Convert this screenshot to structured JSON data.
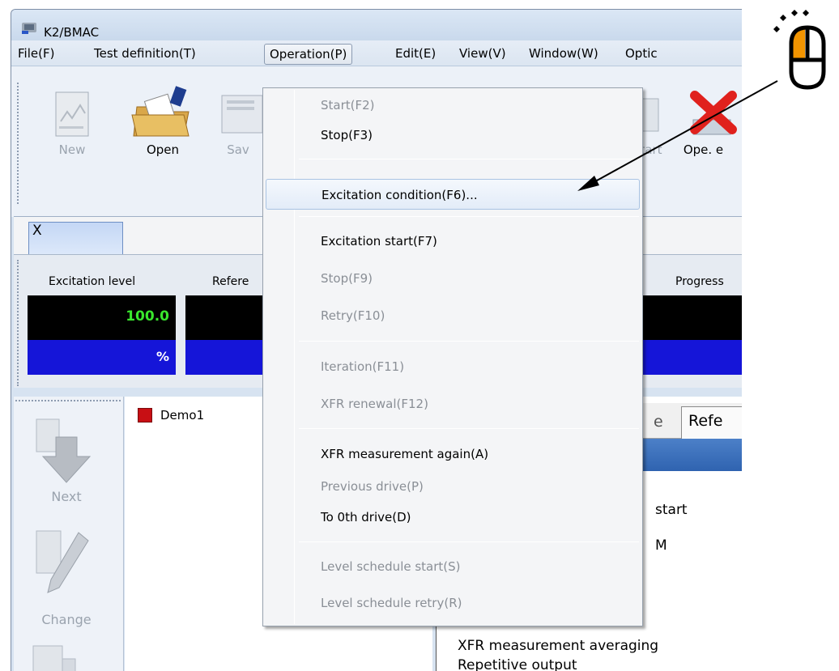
{
  "window": {
    "title": "K2/BMAC"
  },
  "menubar": [
    "File(F)",
    "Test definition(T)",
    "Operation(P)",
    "Edit(E)",
    "View(V)",
    "Window(W)",
    "Optic"
  ],
  "toolbar": {
    "new_label": "New",
    "open_label": "Open",
    "save_label": "Sav",
    "start_label": "tart",
    "ope_label": "Ope. e"
  },
  "tab": {
    "label": "X"
  },
  "monitor": {
    "excitation_label": "Excitation level",
    "reference_label": "Refere",
    "progress_label": "Progress",
    "excitation_value": "100.0",
    "excitation_unit": "%"
  },
  "side_toolbar": {
    "next_label": "Next",
    "change_label": "Change"
  },
  "tree": {
    "item": "Demo1"
  },
  "right_panel": {
    "tabs": [
      "e",
      "Refe"
    ],
    "lines": [
      "start",
      "M",
      "XFR measurement averaging",
      "Repetitive output"
    ]
  },
  "operation_menu": {
    "items": [
      {
        "label": "Start(F2)",
        "enabled": false
      },
      {
        "label": "Stop(F3)",
        "enabled": true
      },
      {
        "label": "Excitation condition(F6)...",
        "enabled": true,
        "highlighted": true
      },
      {
        "label": "Excitation start(F7)",
        "enabled": true
      },
      {
        "label": "Stop(F9)",
        "enabled": false
      },
      {
        "label": "Retry(F10)",
        "enabled": false
      },
      {
        "label": "Iteration(F11)",
        "enabled": false
      },
      {
        "label": "XFR renewal(F12)",
        "enabled": false
      },
      {
        "label": "XFR measurement again(A)",
        "enabled": true
      },
      {
        "label": "Previous drive(P)",
        "enabled": false
      },
      {
        "label": "To 0th drive(D)",
        "enabled": true
      },
      {
        "label": "Level schedule start(S)",
        "enabled": false
      },
      {
        "label": "Level schedule retry(R)",
        "enabled": false
      }
    ]
  },
  "colors": {
    "value_green": "#39e62d",
    "unit_blue": "#1515d8",
    "mouse_accent": "#f29400"
  },
  "icons": [
    "app-icon",
    "new-icon",
    "open-folder-icon",
    "save-icon",
    "ope-end-icon",
    "next-arrow-icon",
    "change-pencil-icon",
    "mouse-click-icon"
  ]
}
